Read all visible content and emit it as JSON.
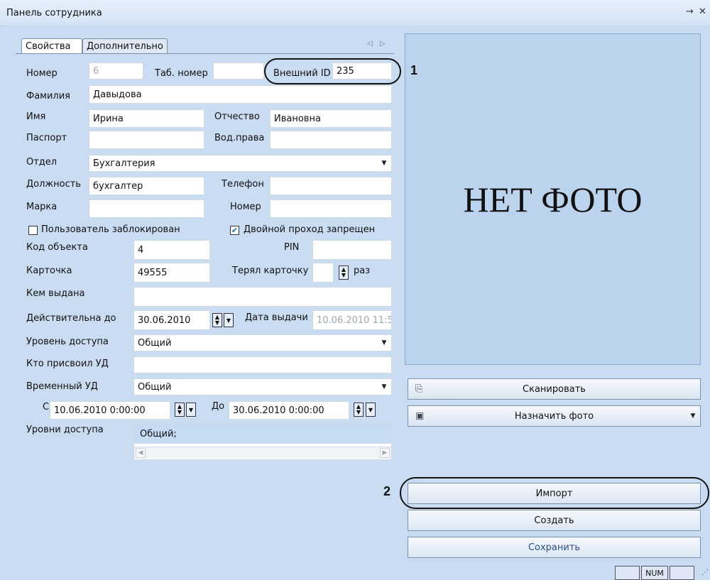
{
  "window": {
    "title": "Панель сотрудника",
    "pin_icon": "pin-icon",
    "close_icon": "close-icon"
  },
  "tabs": [
    {
      "label": "Свойства",
      "active": true
    },
    {
      "label": "Дополнительно",
      "active": false
    }
  ],
  "form": {
    "number_label": "Номер",
    "number_value": "6",
    "tab_number_label": "Таб. номер",
    "tab_number_value": "",
    "external_id_label": "Внешний ID",
    "external_id_value": "235",
    "surname_label": "Фамилия",
    "surname_value": "Давыдова",
    "name_label": "Имя",
    "name_value": "Ирина",
    "patronymic_label": "Отчество",
    "patronymic_value": "Ивановна",
    "passport_label": "Паспорт",
    "passport_value": "",
    "license_label": "Вод.права",
    "license_value": "",
    "department_label": "Отдел",
    "department_value": "Бухгалтерия",
    "position_label": "Должность",
    "position_value": "бухгалтер",
    "phone_label": "Телефон",
    "phone_value": "",
    "car_brand_label": "Марка",
    "car_brand_value": "",
    "car_number_label": "Номер",
    "car_number_value": "",
    "blocked_label": "Пользователь заблокирован",
    "blocked_checked": false,
    "double_pass_label": "Двойной проход запрещен",
    "double_pass_checked": true,
    "object_code_label": "Код объекта",
    "object_code_value": "4",
    "pin_label": "PIN",
    "pin_value": "",
    "card_label": "Карточка",
    "card_value": "49555",
    "lost_card_label": "Терял карточку",
    "lost_card_value": "",
    "lost_card_unit": "раз",
    "issued_by_label": "Кем выдана",
    "issued_by_value": "",
    "valid_until_label": "Действительна до",
    "valid_until_value": "30.06.2010",
    "issue_date_label": "Дата выдачи",
    "issue_date_value": "10.06.2010 11:5",
    "access_level_label": "Уровень доступа",
    "access_level_value": "Общий",
    "assigned_by_label": "Кто присвоил УД",
    "assigned_by_value": "",
    "temp_access_label": "Временный УД",
    "temp_access_value": "Общий",
    "from_label": "С",
    "from_value": "10.06.2010 0:00:00",
    "to_label": "До",
    "to_value": "30.06.2010 0:00:00",
    "access_levels_label": "Уровни доступа",
    "access_levels_items": [
      "Общий;"
    ]
  },
  "photo": {
    "placeholder": "НЕТ ФОТО"
  },
  "buttons": {
    "scan": "Сканировать",
    "scan_icon": "scanner-icon",
    "assign_photo": "Назначить фото",
    "assign_photo_icon": "camera-icon",
    "import": "Импорт",
    "create": "Создать",
    "save": "Сохранить"
  },
  "callouts": {
    "one": "1",
    "two": "2"
  },
  "status_bar": {
    "num": "NUM"
  }
}
